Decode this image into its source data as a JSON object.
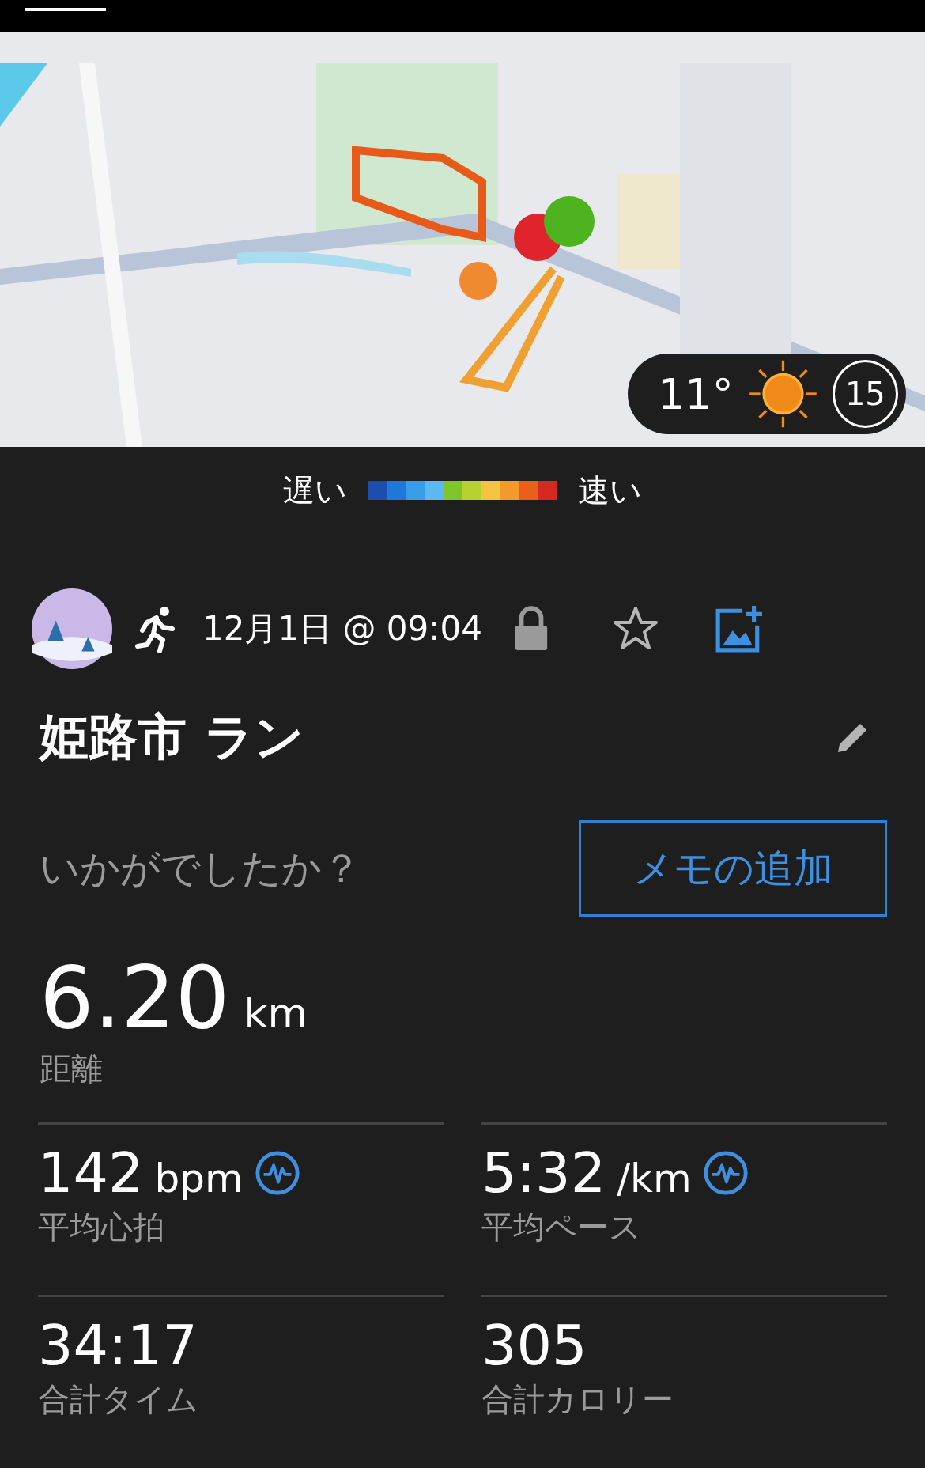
{
  "weather": {
    "temperature": "11°",
    "wind": "15"
  },
  "legend": {
    "slow": "遅い",
    "fast": "速い"
  },
  "activity": {
    "date": "12月1日 @ 09:04",
    "favorite": false,
    "title": "姫路市 ラン"
  },
  "feedback": {
    "question": "いかがでしたか？",
    "button": "メモの追加"
  },
  "distance": {
    "value": "6.20",
    "unit": "km",
    "label": "距離"
  },
  "stats": [
    {
      "value": "142",
      "unit": "bpm",
      "label": "平均心拍",
      "icon": true
    },
    {
      "value": "5:32",
      "unit": "/km",
      "label": "平均ペース",
      "icon": true
    },
    {
      "value": "34:17",
      "label": "合計タイム",
      "icon": false
    },
    {
      "value": "305",
      "label": "合計カロリー",
      "icon": false
    }
  ]
}
